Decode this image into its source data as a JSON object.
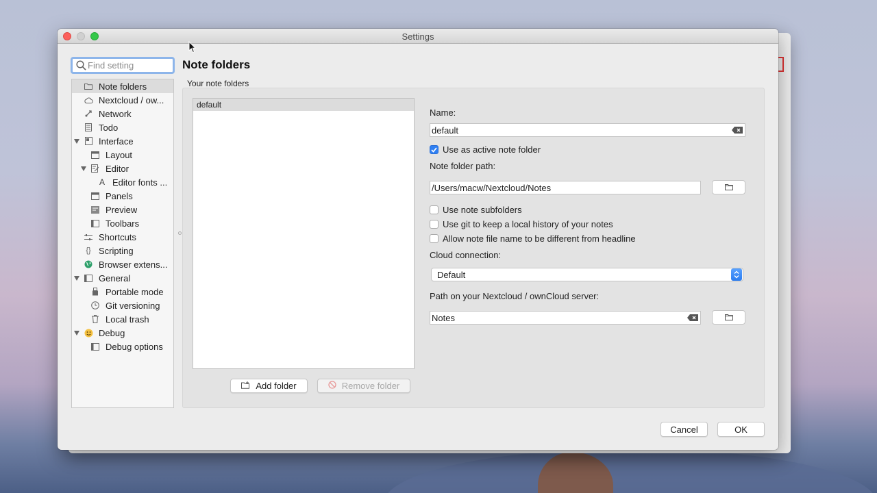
{
  "window": {
    "title": "Settings"
  },
  "search": {
    "placeholder": "Find setting",
    "value": ""
  },
  "sidebar": {
    "items": [
      {
        "label": "Note folders",
        "icon": "folder-icon",
        "level": 0,
        "selected": true
      },
      {
        "label": "Nextcloud / ow...",
        "icon": "cloud-icon",
        "level": 0
      },
      {
        "label": "Network",
        "icon": "network-icon",
        "level": 0
      },
      {
        "label": "Todo",
        "icon": "todo-list-icon",
        "level": 0
      },
      {
        "label": "Interface",
        "icon": "interface-icon",
        "level": 0,
        "expanded": true
      },
      {
        "label": "Layout",
        "icon": "layout-icon",
        "level": 1
      },
      {
        "label": "Editor",
        "icon": "editor-icon",
        "level": 1,
        "expanded": true
      },
      {
        "label": "Editor fonts ...",
        "icon": "font-icon",
        "level": 2
      },
      {
        "label": "Panels",
        "icon": "panels-icon",
        "level": 1
      },
      {
        "label": "Preview",
        "icon": "preview-icon",
        "level": 1
      },
      {
        "label": "Toolbars",
        "icon": "toolbars-icon",
        "level": 1
      },
      {
        "label": "Shortcuts",
        "icon": "shortcuts-icon",
        "level": 0
      },
      {
        "label": "Scripting",
        "icon": "braces-icon",
        "level": 0
      },
      {
        "label": "Browser extens...",
        "icon": "globe-icon",
        "level": 0
      },
      {
        "label": "General",
        "icon": "general-icon",
        "level": 0,
        "expanded": true
      },
      {
        "label": "Portable mode",
        "icon": "usb-icon",
        "level": 1
      },
      {
        "label": "Git versioning",
        "icon": "clock-icon",
        "level": 1
      },
      {
        "label": "Local trash",
        "icon": "trash-icon",
        "level": 1
      },
      {
        "label": "Debug",
        "icon": "smiley-icon",
        "level": 0,
        "expanded": true
      },
      {
        "label": "Debug options",
        "icon": "debug-options-icon",
        "level": 1
      }
    ]
  },
  "main": {
    "page_title": "Note folders",
    "group_label": "Your note folders",
    "folders": [
      "default"
    ],
    "add_folder": "Add folder",
    "remove_folder": "Remove folder",
    "name_label": "Name:",
    "name_value": "default",
    "active_label": "Use as active note folder",
    "active_checked": true,
    "path_label": "Note folder path:",
    "path_value": "/Users/macw/Nextcloud/Notes",
    "subfolders_label": "Use note subfolders",
    "git_label": "Use git to keep a local history of your notes",
    "filename_label": "Allow note file name to be different from headline",
    "cloud_label": "Cloud connection:",
    "cloud_value": "Default",
    "server_path_label": "Path on your Nextcloud / ownCloud server:",
    "server_path_value": "Notes"
  },
  "footer": {
    "cancel": "Cancel",
    "ok": "OK"
  },
  "colors": {
    "accent": "#2f7ff2",
    "focus_ring": "#8db5ea",
    "close": "#fc605c",
    "maximize": "#34c84a"
  }
}
